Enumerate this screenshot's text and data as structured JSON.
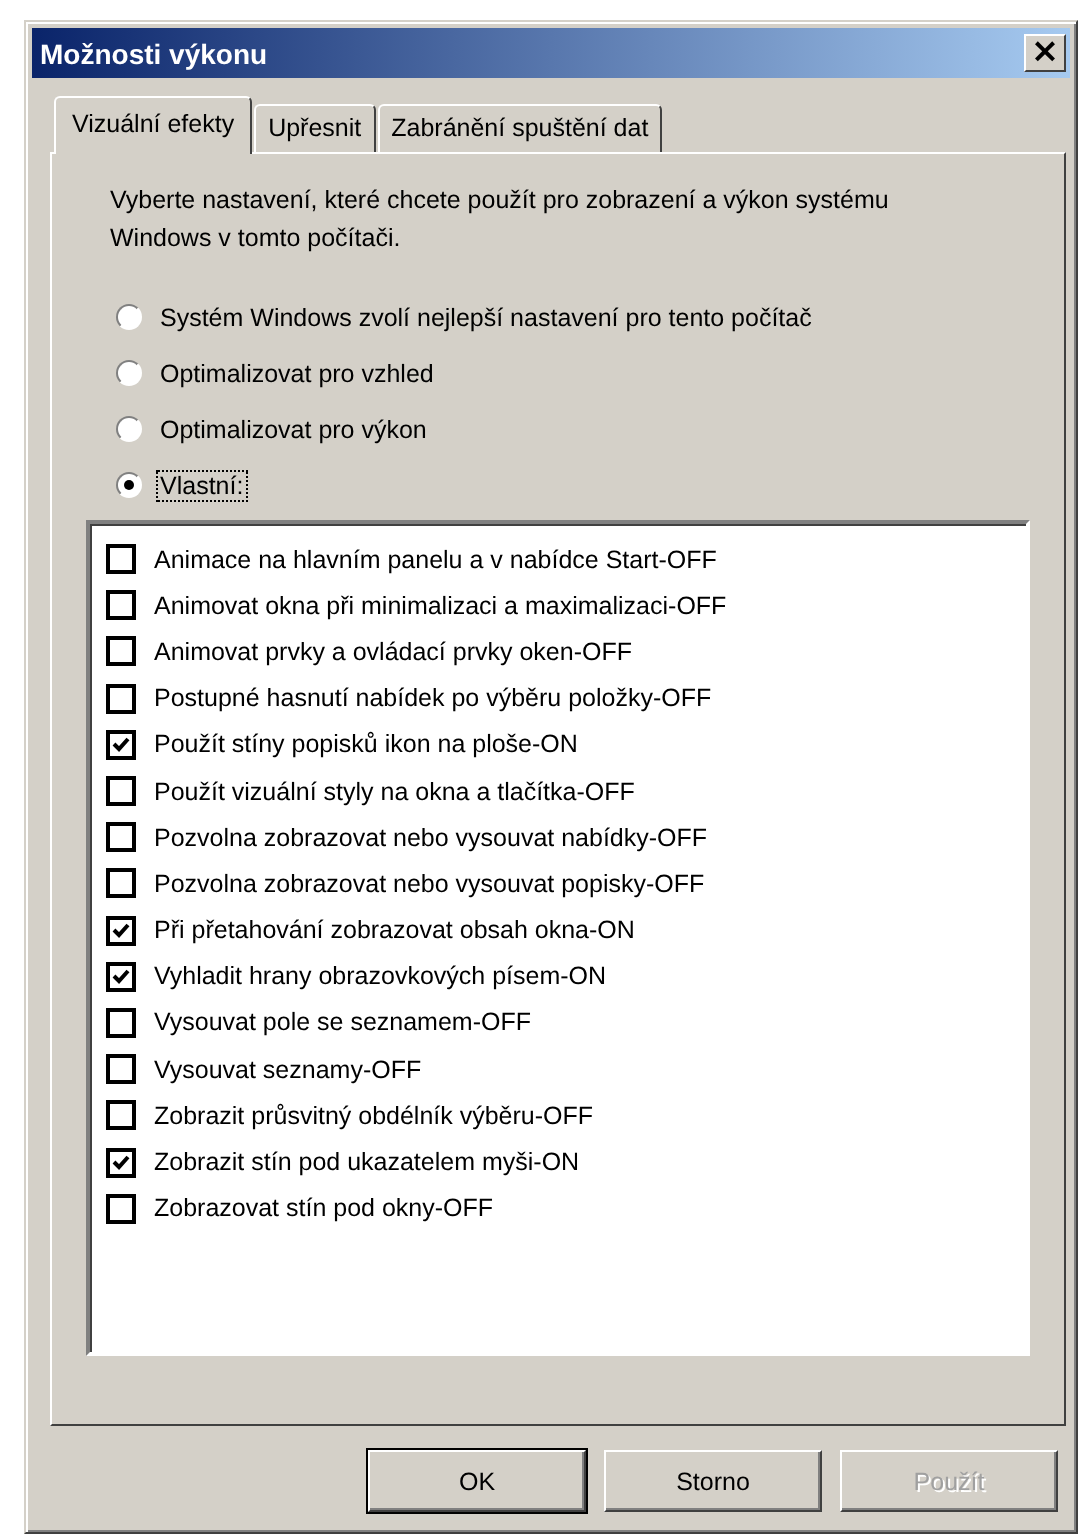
{
  "window": {
    "title": "Možnosti výkonu",
    "close": "×"
  },
  "tabs": [
    {
      "label": "Vizuální efekty",
      "selected": true
    },
    {
      "label": "Upřesnit",
      "selected": false
    },
    {
      "label": "Zabránění spuštění dat",
      "selected": false
    }
  ],
  "description": "Vyberte nastavení, které chcete použít pro zobrazení a výkon systému Windows v tomto počítači.",
  "options": [
    {
      "label": "Systém Windows zvolí nejlepší nastavení pro tento počítač",
      "selected": false,
      "focused": false
    },
    {
      "label": "Optimalizovat pro vzhled",
      "selected": false,
      "focused": false
    },
    {
      "label": "Optimalizovat pro výkon",
      "selected": false,
      "focused": false
    },
    {
      "label": "Vlastní:",
      "selected": true,
      "focused": true
    }
  ],
  "effects": [
    {
      "label": "Animace na hlavním panelu a v nabídce Start-OFF",
      "checked": false
    },
    {
      "label": "Animovat okna při minimalizaci a maximalizaci-OFF",
      "checked": false
    },
    {
      "label": "Animovat prvky a ovládací prvky oken-OFF",
      "checked": false
    },
    {
      "label": "Postupné hasnutí nabídek po výběru položky-OFF",
      "checked": false
    },
    {
      "label": "Použít stíny popisků ikon na ploše-ON",
      "checked": true
    },
    {
      "label": "Použít vizuální styly na okna a tlačítka-OFF",
      "checked": false
    },
    {
      "label": "Pozvolna zobrazovat nebo vysouvat nabídky-OFF",
      "checked": false
    },
    {
      "label": "Pozvolna zobrazovat nebo vysouvat popisky-OFF",
      "checked": false
    },
    {
      "label": "Při přetahování zobrazovat obsah okna-ON",
      "checked": true
    },
    {
      "label": "Vyhladit hrany obrazovkových písem-ON",
      "checked": true
    },
    {
      "label": "Vysouvat pole se seznamem-OFF",
      "checked": false
    },
    {
      "label": "Vysouvat seznamy-OFF",
      "checked": false
    },
    {
      "label": "Zobrazit průsvitný obdélník výběru-OFF",
      "checked": false
    },
    {
      "label": "Zobrazit stín pod ukazatelem myši-ON",
      "checked": true
    },
    {
      "label": "Zobrazovat stín pod okny-OFF",
      "checked": false
    }
  ],
  "buttons": [
    {
      "label": "OK",
      "default": true,
      "disabled": false
    },
    {
      "label": "Storno",
      "default": false,
      "disabled": false
    },
    {
      "label": "Použít",
      "default": false,
      "disabled": true
    }
  ]
}
